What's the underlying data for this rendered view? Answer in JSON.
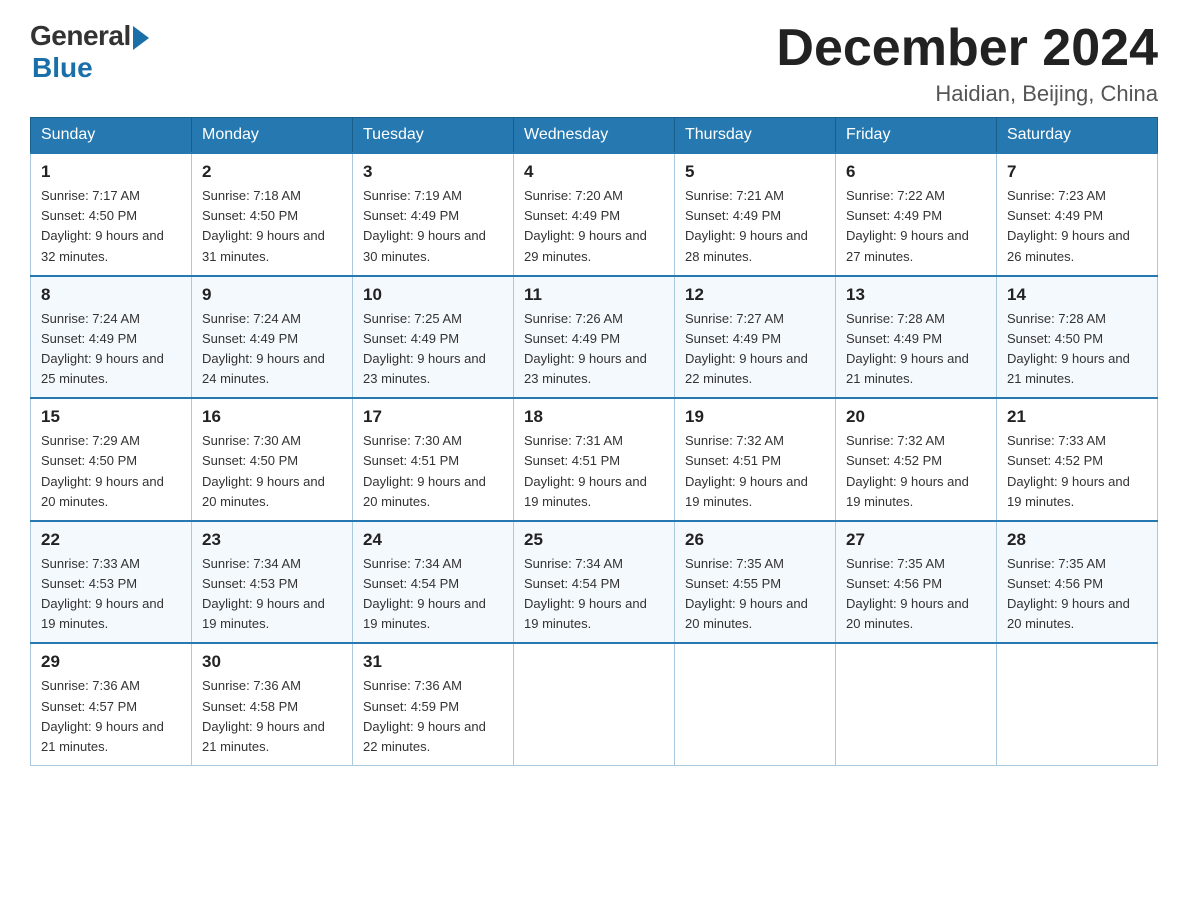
{
  "header": {
    "logo_general": "General",
    "logo_blue": "Blue",
    "month_title": "December 2024",
    "location": "Haidian, Beijing, China"
  },
  "days_of_week": [
    "Sunday",
    "Monday",
    "Tuesday",
    "Wednesday",
    "Thursday",
    "Friday",
    "Saturday"
  ],
  "weeks": [
    [
      {
        "day": "1",
        "sunrise": "7:17 AM",
        "sunset": "4:50 PM",
        "daylight": "9 hours and 32 minutes."
      },
      {
        "day": "2",
        "sunrise": "7:18 AM",
        "sunset": "4:50 PM",
        "daylight": "9 hours and 31 minutes."
      },
      {
        "day": "3",
        "sunrise": "7:19 AM",
        "sunset": "4:49 PM",
        "daylight": "9 hours and 30 minutes."
      },
      {
        "day": "4",
        "sunrise": "7:20 AM",
        "sunset": "4:49 PM",
        "daylight": "9 hours and 29 minutes."
      },
      {
        "day": "5",
        "sunrise": "7:21 AM",
        "sunset": "4:49 PM",
        "daylight": "9 hours and 28 minutes."
      },
      {
        "day": "6",
        "sunrise": "7:22 AM",
        "sunset": "4:49 PM",
        "daylight": "9 hours and 27 minutes."
      },
      {
        "day": "7",
        "sunrise": "7:23 AM",
        "sunset": "4:49 PM",
        "daylight": "9 hours and 26 minutes."
      }
    ],
    [
      {
        "day": "8",
        "sunrise": "7:24 AM",
        "sunset": "4:49 PM",
        "daylight": "9 hours and 25 minutes."
      },
      {
        "day": "9",
        "sunrise": "7:24 AM",
        "sunset": "4:49 PM",
        "daylight": "9 hours and 24 minutes."
      },
      {
        "day": "10",
        "sunrise": "7:25 AM",
        "sunset": "4:49 PM",
        "daylight": "9 hours and 23 minutes."
      },
      {
        "day": "11",
        "sunrise": "7:26 AM",
        "sunset": "4:49 PM",
        "daylight": "9 hours and 23 minutes."
      },
      {
        "day": "12",
        "sunrise": "7:27 AM",
        "sunset": "4:49 PM",
        "daylight": "9 hours and 22 minutes."
      },
      {
        "day": "13",
        "sunrise": "7:28 AM",
        "sunset": "4:49 PM",
        "daylight": "9 hours and 21 minutes."
      },
      {
        "day": "14",
        "sunrise": "7:28 AM",
        "sunset": "4:50 PM",
        "daylight": "9 hours and 21 minutes."
      }
    ],
    [
      {
        "day": "15",
        "sunrise": "7:29 AM",
        "sunset": "4:50 PM",
        "daylight": "9 hours and 20 minutes."
      },
      {
        "day": "16",
        "sunrise": "7:30 AM",
        "sunset": "4:50 PM",
        "daylight": "9 hours and 20 minutes."
      },
      {
        "day": "17",
        "sunrise": "7:30 AM",
        "sunset": "4:51 PM",
        "daylight": "9 hours and 20 minutes."
      },
      {
        "day": "18",
        "sunrise": "7:31 AM",
        "sunset": "4:51 PM",
        "daylight": "9 hours and 19 minutes."
      },
      {
        "day": "19",
        "sunrise": "7:32 AM",
        "sunset": "4:51 PM",
        "daylight": "9 hours and 19 minutes."
      },
      {
        "day": "20",
        "sunrise": "7:32 AM",
        "sunset": "4:52 PM",
        "daylight": "9 hours and 19 minutes."
      },
      {
        "day": "21",
        "sunrise": "7:33 AM",
        "sunset": "4:52 PM",
        "daylight": "9 hours and 19 minutes."
      }
    ],
    [
      {
        "day": "22",
        "sunrise": "7:33 AM",
        "sunset": "4:53 PM",
        "daylight": "9 hours and 19 minutes."
      },
      {
        "day": "23",
        "sunrise": "7:34 AM",
        "sunset": "4:53 PM",
        "daylight": "9 hours and 19 minutes."
      },
      {
        "day": "24",
        "sunrise": "7:34 AM",
        "sunset": "4:54 PM",
        "daylight": "9 hours and 19 minutes."
      },
      {
        "day": "25",
        "sunrise": "7:34 AM",
        "sunset": "4:54 PM",
        "daylight": "9 hours and 19 minutes."
      },
      {
        "day": "26",
        "sunrise": "7:35 AM",
        "sunset": "4:55 PM",
        "daylight": "9 hours and 20 minutes."
      },
      {
        "day": "27",
        "sunrise": "7:35 AM",
        "sunset": "4:56 PM",
        "daylight": "9 hours and 20 minutes."
      },
      {
        "day": "28",
        "sunrise": "7:35 AM",
        "sunset": "4:56 PM",
        "daylight": "9 hours and 20 minutes."
      }
    ],
    [
      {
        "day": "29",
        "sunrise": "7:36 AM",
        "sunset": "4:57 PM",
        "daylight": "9 hours and 21 minutes."
      },
      {
        "day": "30",
        "sunrise": "7:36 AM",
        "sunset": "4:58 PM",
        "daylight": "9 hours and 21 minutes."
      },
      {
        "day": "31",
        "sunrise": "7:36 AM",
        "sunset": "4:59 PM",
        "daylight": "9 hours and 22 minutes."
      },
      null,
      null,
      null,
      null
    ]
  ],
  "labels": {
    "sunrise_prefix": "Sunrise: ",
    "sunset_prefix": "Sunset: ",
    "daylight_prefix": "Daylight: "
  }
}
